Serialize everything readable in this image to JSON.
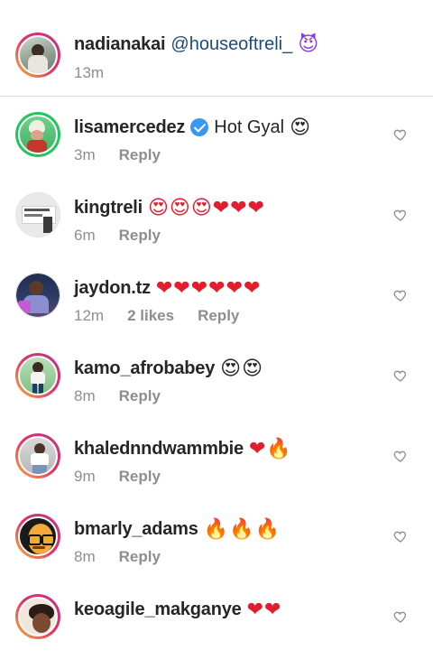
{
  "caption": {
    "username": "nadianakai",
    "mention": "@houseoftreli_",
    "emoji": "😈",
    "time": "13m"
  },
  "comments": [
    {
      "username": "lisamercedez",
      "verified": true,
      "text": "Hot Gyal",
      "emoji": "😍",
      "time": "3m",
      "likes": "",
      "reply": "Reply"
    },
    {
      "username": "kingtreli",
      "verified": false,
      "text": "",
      "emoji": "😍😍😍❤❤❤",
      "time": "6m",
      "likes": "",
      "reply": "Reply"
    },
    {
      "username": "jaydon.tz",
      "verified": false,
      "text": "",
      "emoji": "❤❤❤❤❤❤",
      "time": "12m",
      "likes": "2 likes",
      "reply": "Reply"
    },
    {
      "username": "kamo_afrobabey",
      "verified": false,
      "text": "",
      "emoji": "😍😍",
      "time": "8m",
      "likes": "",
      "reply": "Reply"
    },
    {
      "username": "khalednndwammbie",
      "verified": false,
      "text": "",
      "emoji": "❤🔥",
      "time": "9m",
      "likes": "",
      "reply": "Reply"
    },
    {
      "username": "bmarly_adams",
      "verified": false,
      "text": "",
      "emoji": "🔥🔥🔥",
      "time": "8m",
      "likes": "",
      "reply": "Reply"
    },
    {
      "username": "keoagile_makganye",
      "verified": false,
      "text": "",
      "emoji": "❤❤",
      "time": "",
      "likes": "",
      "reply": ""
    }
  ],
  "icons": {
    "heart": "heart-outline-icon",
    "verified": "verified-badge-icon"
  },
  "colors": {
    "mention": "#1e4a78",
    "meta": "#8e8e8e",
    "verified": "#3897f0",
    "heart_red": "#e11d2e"
  }
}
